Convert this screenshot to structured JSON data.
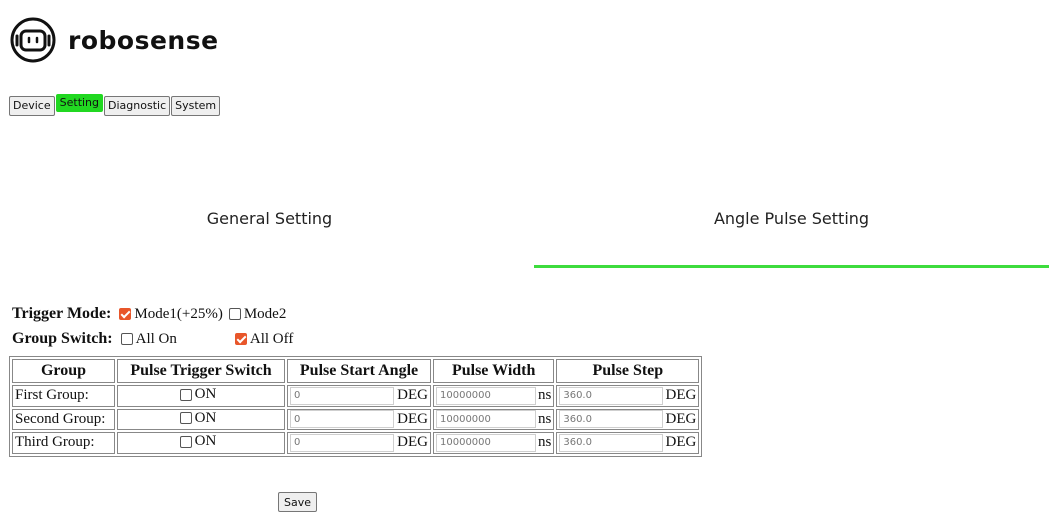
{
  "brand": {
    "name": "robosense"
  },
  "top_tabs": [
    {
      "label": "Device"
    },
    {
      "label": "Setting",
      "active": true
    },
    {
      "label": "Diagnostic"
    },
    {
      "label": "System"
    }
  ],
  "sub_tabs": {
    "general": "General Setting",
    "angle": "Angle Pulse Setting",
    "active": "angle"
  },
  "trigger_mode": {
    "label": "Trigger Mode:",
    "options": [
      {
        "label": "Mode1(+25%)",
        "checked": true
      },
      {
        "label": "Mode2",
        "checked": false
      }
    ]
  },
  "group_switch": {
    "label": "Group Switch:",
    "options": [
      {
        "label": "All On",
        "checked": false
      },
      {
        "label": "All Off",
        "checked": true
      }
    ]
  },
  "table": {
    "headers": [
      "Group",
      "Pulse Trigger Switch",
      "Pulse Start Angle",
      "Pulse Width",
      "Pulse Step"
    ],
    "rows": [
      {
        "group": "First Group:",
        "switch_label": "ON",
        "start_angle": "0",
        "start_unit": "DEG",
        "width": "10000000",
        "width_unit": "ns",
        "step": "360.0",
        "step_unit": "DEG"
      },
      {
        "group": "Second Group:",
        "switch_label": "ON",
        "start_angle": "0",
        "start_unit": "DEG",
        "width": "10000000",
        "width_unit": "ns",
        "step": "360.0",
        "step_unit": "DEG"
      },
      {
        "group": "Third Group:",
        "switch_label": "ON",
        "start_angle": "0",
        "start_unit": "DEG",
        "width": "10000000",
        "width_unit": "ns",
        "step": "360.0",
        "step_unit": "DEG"
      }
    ]
  },
  "save_label": "Save",
  "colors": {
    "active_tab": "#21d821",
    "underline": "#3ddc3d",
    "checkbox_checked": "#e8562a"
  }
}
